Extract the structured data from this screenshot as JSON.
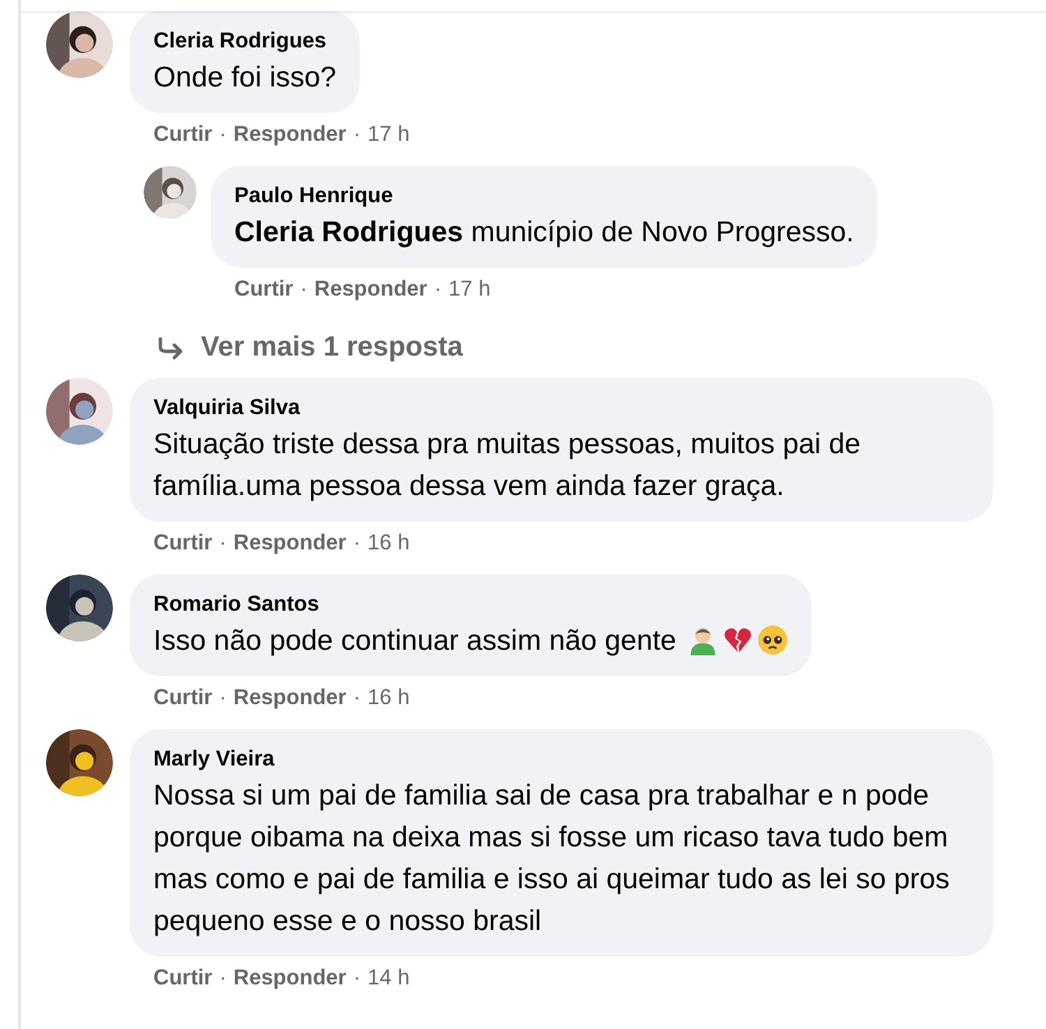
{
  "comments": [
    {
      "author": "Cleria Rodrigues",
      "text": "Onde foi isso?",
      "actions": [
        {
          "kind": "link",
          "text": "Curtir"
        },
        {
          "kind": "sep",
          "text": "·"
        },
        {
          "kind": "link",
          "text": "Responder"
        },
        {
          "kind": "sep",
          "text": "·"
        },
        {
          "kind": "time",
          "text": "17 h"
        }
      ],
      "replies": [
        {
          "author": "Paulo Henrique",
          "text": "**Cleria Rodrigues** município de Novo Progresso.",
          "actions": [
            {
              "kind": "link",
              "text": "Curtir"
            },
            {
              "kind": "sep",
              "text": "·"
            },
            {
              "kind": "link",
              "text": "Responder"
            },
            {
              "kind": "sep",
              "text": "·"
            },
            {
              "kind": "time",
              "text": "17 h"
            }
          ]
        }
      ],
      "more_replies": "Ver mais 1 resposta"
    },
    {
      "author": "Valquiria Silva",
      "text": "Situação triste dessa pra muitas pessoas, muitos pai de família.uma pessoa dessa vem ainda fazer graça.",
      "actions": [
        {
          "kind": "link",
          "text": "Curtir"
        },
        {
          "kind": "sep",
          "text": "·"
        },
        {
          "kind": "link",
          "text": "Responder"
        },
        {
          "kind": "sep",
          "text": "·"
        },
        {
          "kind": "time",
          "text": "16 h"
        }
      ]
    },
    {
      "author": "Romario Santos",
      "text": "Isso não pode continuar assim não gente",
      "emojis": [
        {
          "kind": "person"
        },
        {
          "kind": "broken_heart"
        },
        {
          "kind": "pleading_face"
        }
      ],
      "actions": [
        {
          "kind": "link",
          "text": "Curtir"
        },
        {
          "kind": "sep",
          "text": "·"
        },
        {
          "kind": "link",
          "text": "Responder"
        },
        {
          "kind": "sep",
          "text": "·"
        },
        {
          "kind": "time",
          "text": "16 h"
        }
      ]
    },
    {
      "author": "Marly Vieira",
      "text": "Nossa si um pai de familia sai de casa pra trabalhar e n pode porque oibama na deixa mas si fosse um ricaso tava tudo bem mas como e pai de familia e isso ai queimar tudo as lei so pros pequeno esse e o nosso brasil",
      "actions": [
        {
          "kind": "link",
          "text": "Curtir"
        },
        {
          "kind": "sep",
          "text": "·"
        },
        {
          "kind": "link",
          "text": "Responder"
        },
        {
          "kind": "sep",
          "text": "·"
        },
        {
          "kind": "time",
          "text": "14 h"
        }
      ]
    }
  ]
}
